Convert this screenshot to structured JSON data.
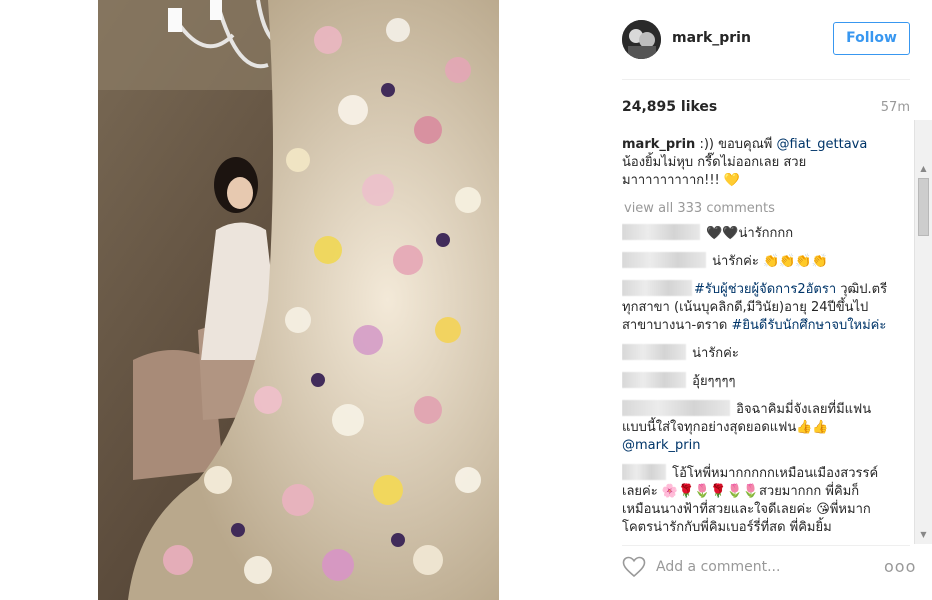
{
  "post": {
    "username": "mark_prin",
    "follow_label": "Follow",
    "likes": "24,895 likes",
    "time": "57m",
    "caption": {
      "username": "mark_prin",
      "text_before": " :)) ขอบคุณพี่ ",
      "mention": "@fiat_gettava",
      "text_after": " น้องยิ้มไม่หุบ กรี๊ดไม่ออกเลย สวย มาาาาาาาาาก!!! ",
      "emoji": "💛"
    },
    "view_all": "view all 333 comments",
    "comments": [
      {
        "text": " 🖤🖤น่ารักกกก",
        "hidden_w": 78
      },
      {
        "text": " น่ารักค่ะ 👏👏👏👏",
        "hidden_w": 84
      },
      {
        "hashtag1": "#รับผู้ช่วยผู้จัดการ2อัตรา",
        "text": " วุฒิป.ตรีทุกสาขา (เน้นบุคลิกดี,มีวินัย)อายุ 24ปีขึ้นไปสาขาบางนา-ตราด ",
        "hashtag2": "#ยินดีรับนักศึกษาจบใหม่ค่ะ",
        "hidden_w": 70
      },
      {
        "text": " น่ารักค่ะ",
        "hidden_w": 64
      },
      {
        "text": " อุ้ยๆๆๆๆ",
        "hidden_w": 64
      },
      {
        "text": " อิจฉาคิมมี่จังเลยที่มีแฟนแบบนี้ใส่ใจทุกอย่างสุดยอดแฟน👍👍 ",
        "mention": "@mark_prin",
        "hidden_w": 108
      },
      {
        "text": " โอ้โหพี่หมากกกกกเหมือนเมืองสวรรค์เลยค่ะ 🌸🌹🌷🌹🌷🌷สวยมากกก พี่คิมก็เหมือนนางฟ้าที่สวยและใจดีเลยค่ะ 😘พี่หมากโคตรน่ารักกับพี่คิมเบอร์รี่ที่สุด พี่คิมยิ้ม",
        "hidden_w": 44
      }
    ],
    "add_comment_placeholder": "Add a comment...",
    "more_label": "ooo"
  },
  "colors": {
    "accent": "#3897f0",
    "mention": "#003569",
    "muted": "#999999",
    "text": "#262626"
  },
  "icons": {
    "like": "heart-outline-icon",
    "more": "more-dots-icon"
  }
}
